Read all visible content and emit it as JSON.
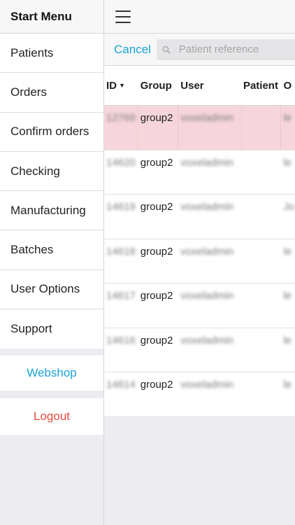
{
  "sidebar": {
    "title": "Start Menu",
    "items": [
      {
        "label": "Patients"
      },
      {
        "label": "Orders"
      },
      {
        "label": "Confirm orders"
      },
      {
        "label": "Checking"
      },
      {
        "label": "Manufacturing"
      },
      {
        "label": "Batches"
      },
      {
        "label": "User Options"
      },
      {
        "label": "Support"
      }
    ],
    "webshop": "Webshop",
    "logout": "Logout"
  },
  "search": {
    "cancel": "Cancel",
    "placeholder": "Patient reference"
  },
  "table": {
    "columns": {
      "id": "ID",
      "group": "Group",
      "user": "User",
      "patient": "Patient",
      "o": "O"
    },
    "rows": [
      {
        "id": "12769",
        "group": "group2",
        "user": "voxeladmin",
        "patient": "",
        "o": "le",
        "selected": true
      },
      {
        "id": "14620",
        "group": "group2",
        "user": "voxeladmin",
        "patient": "",
        "o": "le"
      },
      {
        "id": "14619",
        "group": "group2",
        "user": "voxeladmin",
        "patient": "",
        "o": "Jo"
      },
      {
        "id": "14618",
        "group": "group2",
        "user": "voxeladmin",
        "patient": "",
        "o": "le"
      },
      {
        "id": "14617",
        "group": "group2",
        "user": "voxeladmin",
        "patient": "",
        "o": "le"
      },
      {
        "id": "14616",
        "group": "group2",
        "user": "voxeladmin",
        "patient": "",
        "o": "le"
      },
      {
        "id": "14614",
        "group": "group2",
        "user": "voxeladmin",
        "patient": "",
        "o": "le"
      }
    ]
  },
  "colors": {
    "accent": "#1aa4d6",
    "logout": "#e84b3c",
    "selected_row": "#f6d6dc"
  }
}
